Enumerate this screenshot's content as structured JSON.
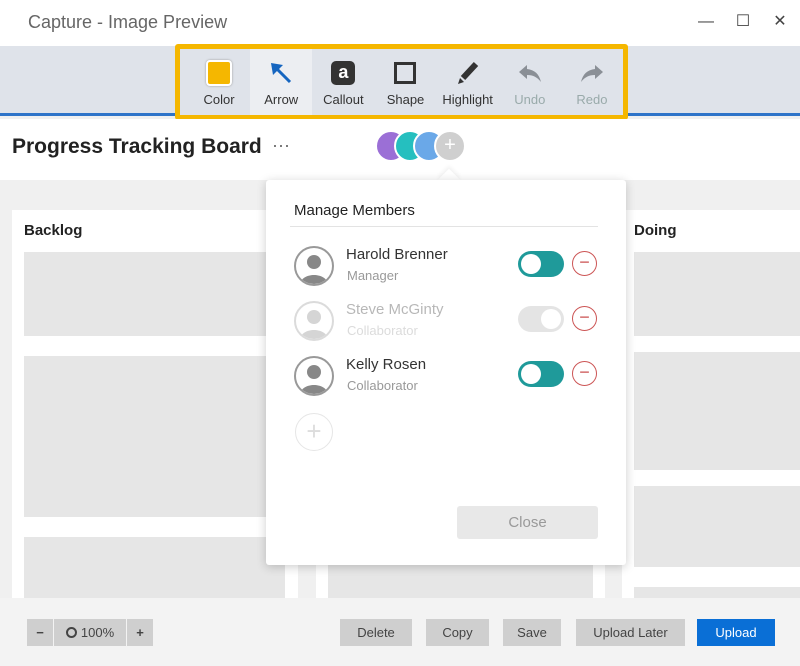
{
  "window": {
    "title": "Capture - Image Preview",
    "minimize": "—",
    "maximize": "☐",
    "close": "✕"
  },
  "toolbar": {
    "items": [
      {
        "label": "Color",
        "icon": "color-swatch-icon",
        "color": "#f5b700"
      },
      {
        "label": "Arrow",
        "icon": "arrow-icon",
        "selected": true
      },
      {
        "label": "Callout",
        "icon": "callout-icon",
        "glyph": "a"
      },
      {
        "label": "Shape",
        "icon": "square-icon"
      },
      {
        "label": "Highlight",
        "icon": "pen-icon"
      },
      {
        "label": "Undo",
        "icon": "undo-icon",
        "disabled": true
      },
      {
        "label": "Redo",
        "icon": "redo-icon",
        "disabled": true
      }
    ]
  },
  "board": {
    "title": "Progress Tracking Board",
    "more": "···",
    "add_member": "+",
    "columns": [
      {
        "title": "Backlog"
      },
      {
        "title": "Doing"
      }
    ]
  },
  "members_popup": {
    "title": "Manage Members",
    "members": [
      {
        "name": "Harold Brenner",
        "role": "Manager",
        "enabled": true
      },
      {
        "name": "Steve McGinty",
        "role": "Collaborator",
        "enabled": false
      },
      {
        "name": "Kelly Rosen",
        "role": "Collaborator",
        "enabled": true
      }
    ],
    "add": "+",
    "remove": "−",
    "close_label": "Close"
  },
  "footer": {
    "zoom_out": "−",
    "zoom_level": "100%",
    "zoom_in": "+",
    "delete": "Delete",
    "copy": "Copy",
    "save": "Save",
    "upload_later": "Upload Later",
    "upload": "Upload"
  },
  "colors": {
    "accent": "#0a6fd6",
    "highlight": "#f5b700",
    "toggle_on": "#1f9a9a",
    "remove": "#cc5555"
  }
}
